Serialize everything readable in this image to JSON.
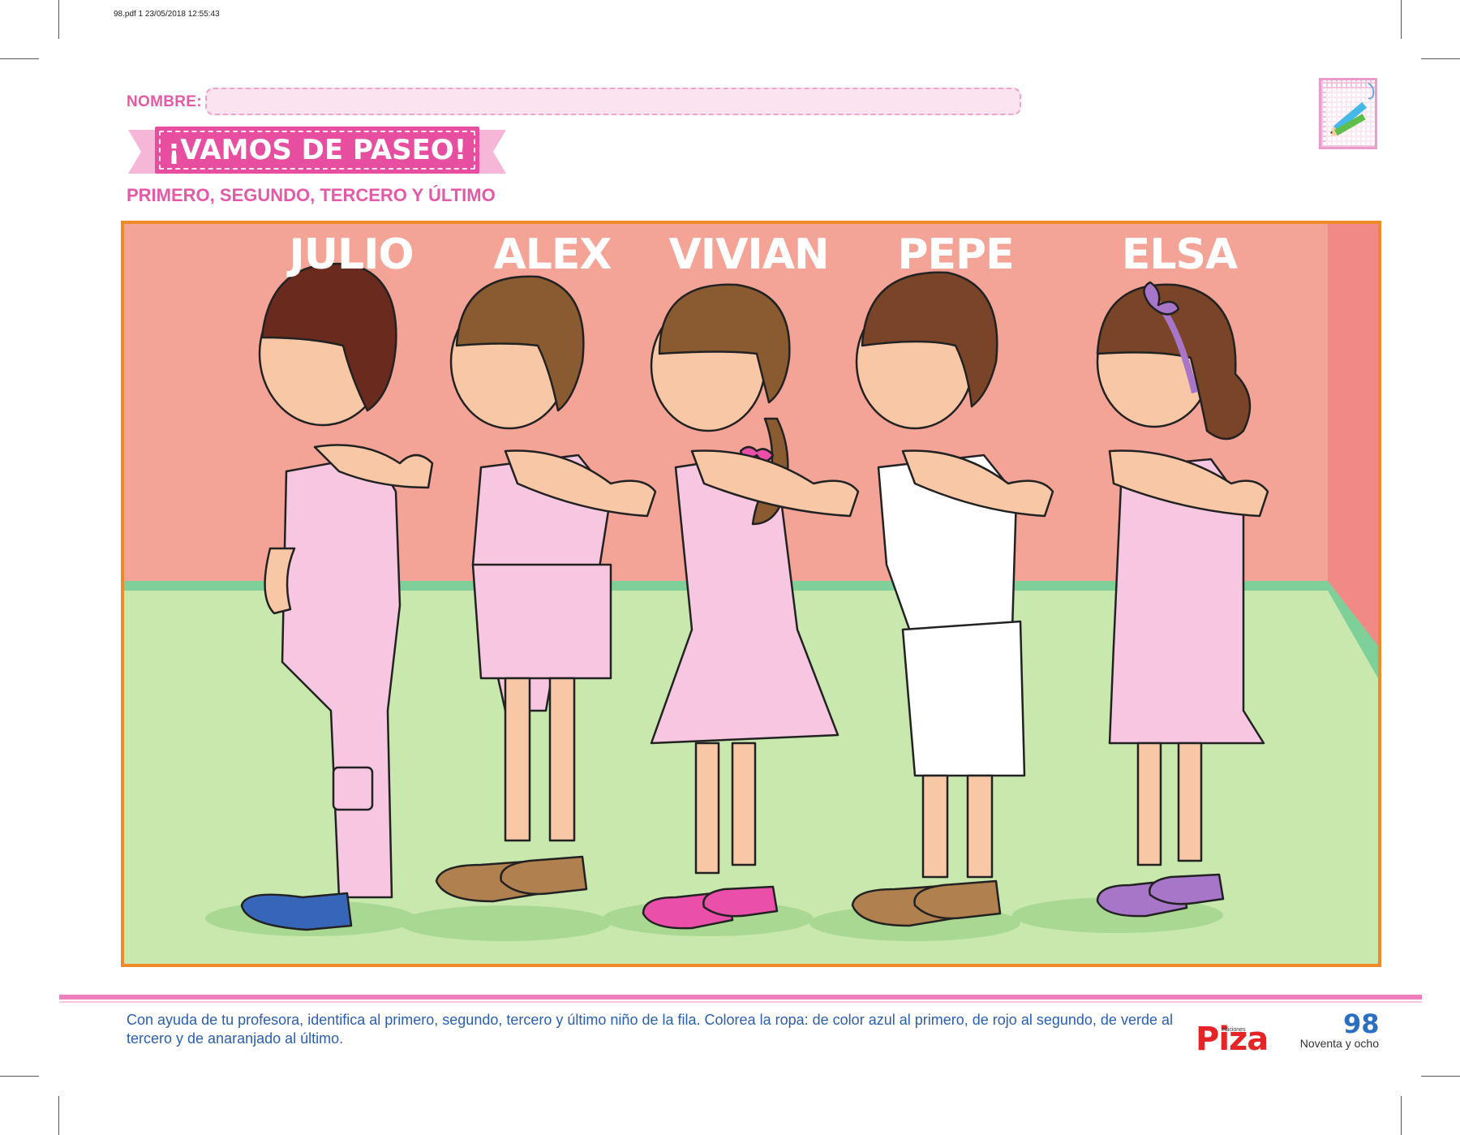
{
  "print_info": "98.pdf   1   23/05/2018   12:55:43",
  "header": {
    "name_label": "NOMBRE:",
    "title": "¡VAMOS DE PASEO!",
    "subtitle": "PRIMERO, SEGUNDO, TERCERO Y ÚLTIMO",
    "badge_icon": "pencil-icon"
  },
  "scene": {
    "children": [
      {
        "name": "JULIO",
        "outfit_color": "#f7c6e1",
        "hair_color": "#6b2a1e",
        "shoe_color": "#3766b8"
      },
      {
        "name": "ALEX",
        "outfit_color": "#f7c6e1",
        "hair_color": "#8a5a30",
        "shoe_color": "#b0814f"
      },
      {
        "name": "VIVIAN",
        "outfit_color": "#f7c6e1",
        "hair_color": "#8a5a30",
        "shoe_color": "#ea4fa9"
      },
      {
        "name": "PEPE",
        "outfit_color": "#ffffff",
        "hair_color": "#7a4428",
        "shoe_color": "#b0814f"
      },
      {
        "name": "ELSA",
        "outfit_color": "#f7c6e1",
        "hair_color": "#7a4428",
        "shoe_color": "#a876c9"
      }
    ],
    "wall_color": "#f4a497",
    "floor_color": "#c8e8ae"
  },
  "footer": {
    "instructions": "Con ayuda de tu profesora, identifica al primero, segundo, tercero y último niño de la fila. Colorea la ropa: de color azul al primero, de rojo al segundo, de verde al tercero y de anaranjado al último.",
    "publisher_small": "ediciones",
    "publisher": "Piza",
    "page_number": "98",
    "page_words": "Noventa y ocho"
  }
}
